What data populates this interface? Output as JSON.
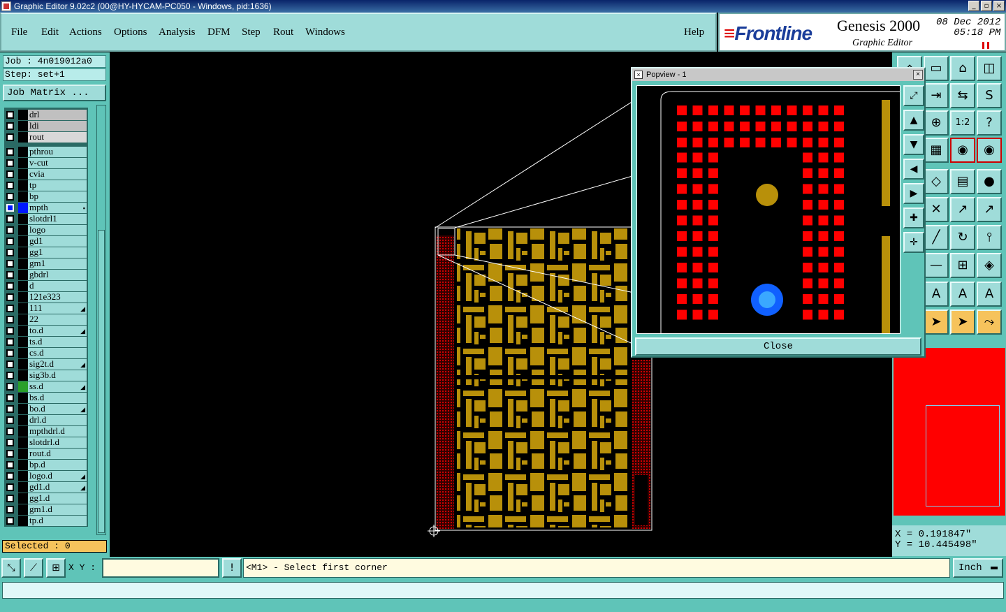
{
  "window": {
    "title": "Graphic Editor 9.02c2 (00@HY-HYCAM-PC050 - Windows, pid:1636)"
  },
  "menu": {
    "file": "File",
    "edit": "Edit",
    "actions": "Actions",
    "options": "Options",
    "analysis": "Analysis",
    "dfm": "DFM",
    "step": "Step",
    "rout": "Rout",
    "windows": "Windows",
    "help": "Help"
  },
  "brand": {
    "logo": "Frontline",
    "product": "Genesis 2000",
    "subtitle": "Graphic Editor",
    "date": "08 Dec 2012",
    "time": "05:18 PM"
  },
  "job": {
    "job": "Job : 4n019012a0",
    "step": "Step: set+1",
    "matrix_button": "Job Matrix ..."
  },
  "layers_top": [
    {
      "name": "drl",
      "shade": "grey",
      "color": "#000000"
    },
    {
      "name": "ldi",
      "shade": "grey",
      "color": "#000000"
    },
    {
      "name": "rout",
      "shade": "lgrey",
      "color": "#000000"
    }
  ],
  "layers": [
    {
      "name": "pthrou",
      "color": "#000000",
      "mark": ""
    },
    {
      "name": "v-cut",
      "color": "#000000",
      "mark": ""
    },
    {
      "name": "cvia",
      "color": "#000000",
      "mark": ""
    },
    {
      "name": "tp",
      "color": "#000000",
      "mark": ""
    },
    {
      "name": "bp",
      "color": "#000000",
      "mark": ""
    },
    {
      "name": "mpth",
      "color": "#0018ff",
      "mark": "▪",
      "active": true
    },
    {
      "name": "slotdrl1",
      "color": "#000000",
      "mark": ""
    },
    {
      "name": "logo",
      "color": "#000000",
      "mark": ""
    },
    {
      "name": "gd1",
      "color": "#000000",
      "mark": ""
    },
    {
      "name": "gg1",
      "color": "#000000",
      "mark": ""
    },
    {
      "name": "gm1",
      "color": "#000000",
      "mark": ""
    },
    {
      "name": "gbdrl",
      "color": "#000000",
      "mark": ""
    },
    {
      "name": "d",
      "color": "#000000",
      "mark": ""
    },
    {
      "name": "121e323",
      "color": "#000000",
      "mark": ""
    },
    {
      "name": "111",
      "color": "#000000",
      "mark": "◢"
    },
    {
      "name": "22",
      "color": "#000000",
      "mark": ""
    },
    {
      "name": "to.d",
      "color": "#000000",
      "mark": "◢"
    },
    {
      "name": "ts.d",
      "color": "#000000",
      "mark": ""
    },
    {
      "name": "cs.d",
      "color": "#000000",
      "mark": ""
    },
    {
      "name": "sig2t.d",
      "color": "#000000",
      "mark": "◢"
    },
    {
      "name": "sig3b.d",
      "color": "#000000",
      "mark": ""
    },
    {
      "name": "ss.d",
      "color": "#2aa02a",
      "mark": "◢"
    },
    {
      "name": "bs.d",
      "color": "#000000",
      "mark": ""
    },
    {
      "name": "bo.d",
      "color": "#000000",
      "mark": "◢"
    },
    {
      "name": "drl.d",
      "color": "#000000",
      "mark": ""
    },
    {
      "name": "mpthdrl.d",
      "color": "#000000",
      "mark": ""
    },
    {
      "name": "slotdrl.d",
      "color": "#000000",
      "mark": ""
    },
    {
      "name": "rout.d",
      "color": "#000000",
      "mark": ""
    },
    {
      "name": "bp.d",
      "color": "#000000",
      "mark": ""
    },
    {
      "name": "logo.d",
      "color": "#000000",
      "mark": "◢"
    },
    {
      "name": "gd1.d",
      "color": "#000000",
      "mark": "◢"
    },
    {
      "name": "gg1.d",
      "color": "#000000",
      "mark": ""
    },
    {
      "name": "gm1.d",
      "color": "#000000",
      "mark": ""
    },
    {
      "name": "tp.d",
      "color": "#000000",
      "mark": ""
    }
  ],
  "selected": "Selected : 0",
  "popview": {
    "title": "Popview - 1",
    "close_label": "Close"
  },
  "coords": {
    "x": "X = 0.191847\"",
    "y": "Y = 10.445498\""
  },
  "bottom": {
    "xy_label": "X Y :",
    "xy_value": "",
    "message": "<M1> - Select first corner",
    "unit": "Inch",
    "bang": "!"
  },
  "colors": {
    "panel": "#5fc4b8",
    "menu": "#9fdcd9",
    "copper": "#b8900a",
    "pads": "#ff0000",
    "via": "#1060ff"
  },
  "tools": [
    "home-icon",
    "hand-icon",
    "view-icon",
    "grid-icon",
    "help-icon",
    "zoom-icon",
    "ratio-icon",
    "layers-icon",
    "measure-icon",
    "circle-icon",
    "select-icon"
  ]
}
